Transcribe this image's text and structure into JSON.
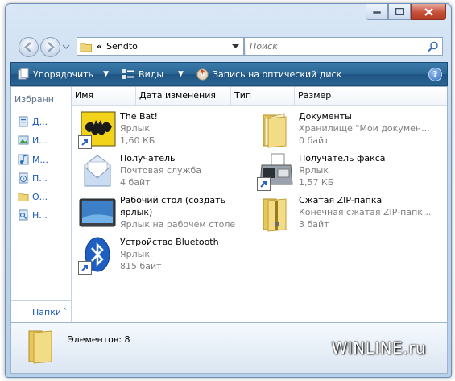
{
  "window": {
    "path_chevron": "«",
    "path": "Sendto"
  },
  "search": {
    "placeholder": "Поиск"
  },
  "toolbar": {
    "organize": "Упорядочить",
    "views": "Виды",
    "burn": "Запись на оптический диск",
    "help": "?"
  },
  "navpane": {
    "header": "Избранн",
    "links": [
      {
        "label": "Д...",
        "icon": "documents-icon"
      },
      {
        "label": "И...",
        "icon": "pictures-icon"
      },
      {
        "label": "М...",
        "icon": "music-icon"
      },
      {
        "label": "П...",
        "icon": "recent-icon"
      },
      {
        "label": "О...",
        "icon": "folder-icon"
      },
      {
        "label": "Н...",
        "icon": "searches-icon"
      }
    ],
    "folders": "Папки",
    "folders_arrow": "˄"
  },
  "columns": [
    "Имя",
    "Дата изменения",
    "Тип",
    "Размер"
  ],
  "items": [
    {
      "name": "The Bat!",
      "type": "Ярлык",
      "size": "1,60 КБ",
      "icon": "the-bat-icon"
    },
    {
      "name": "Документы",
      "type": "Хранилище \"Мои докумен...",
      "size": "0 байт",
      "icon": "documents-folder-icon"
    },
    {
      "name": "Получатель",
      "type": "Почтовая служба",
      "size": "4 байт",
      "icon": "mail-envelope-icon"
    },
    {
      "name": "Получатель факса",
      "type": "Ярлык",
      "size": "1,57 КБ",
      "icon": "fax-icon"
    },
    {
      "name": "Рабочий стол (создать",
      "name2": "ярлык)",
      "type": "Ярлык на рабочем столе",
      "icon": "desktop-icon"
    },
    {
      "name": "Сжатая ZIP-папка",
      "type": "Конечная сжатая ZIP-папк...",
      "size": "3 байт",
      "icon": "zip-folder-icon"
    },
    {
      "name": "Устройство Bluetooth",
      "type": "Ярлык",
      "size": "815 байт",
      "icon": "bluetooth-icon"
    }
  ],
  "status": {
    "text": "Элементов: 8"
  },
  "watermark": "WINLINE.ru"
}
